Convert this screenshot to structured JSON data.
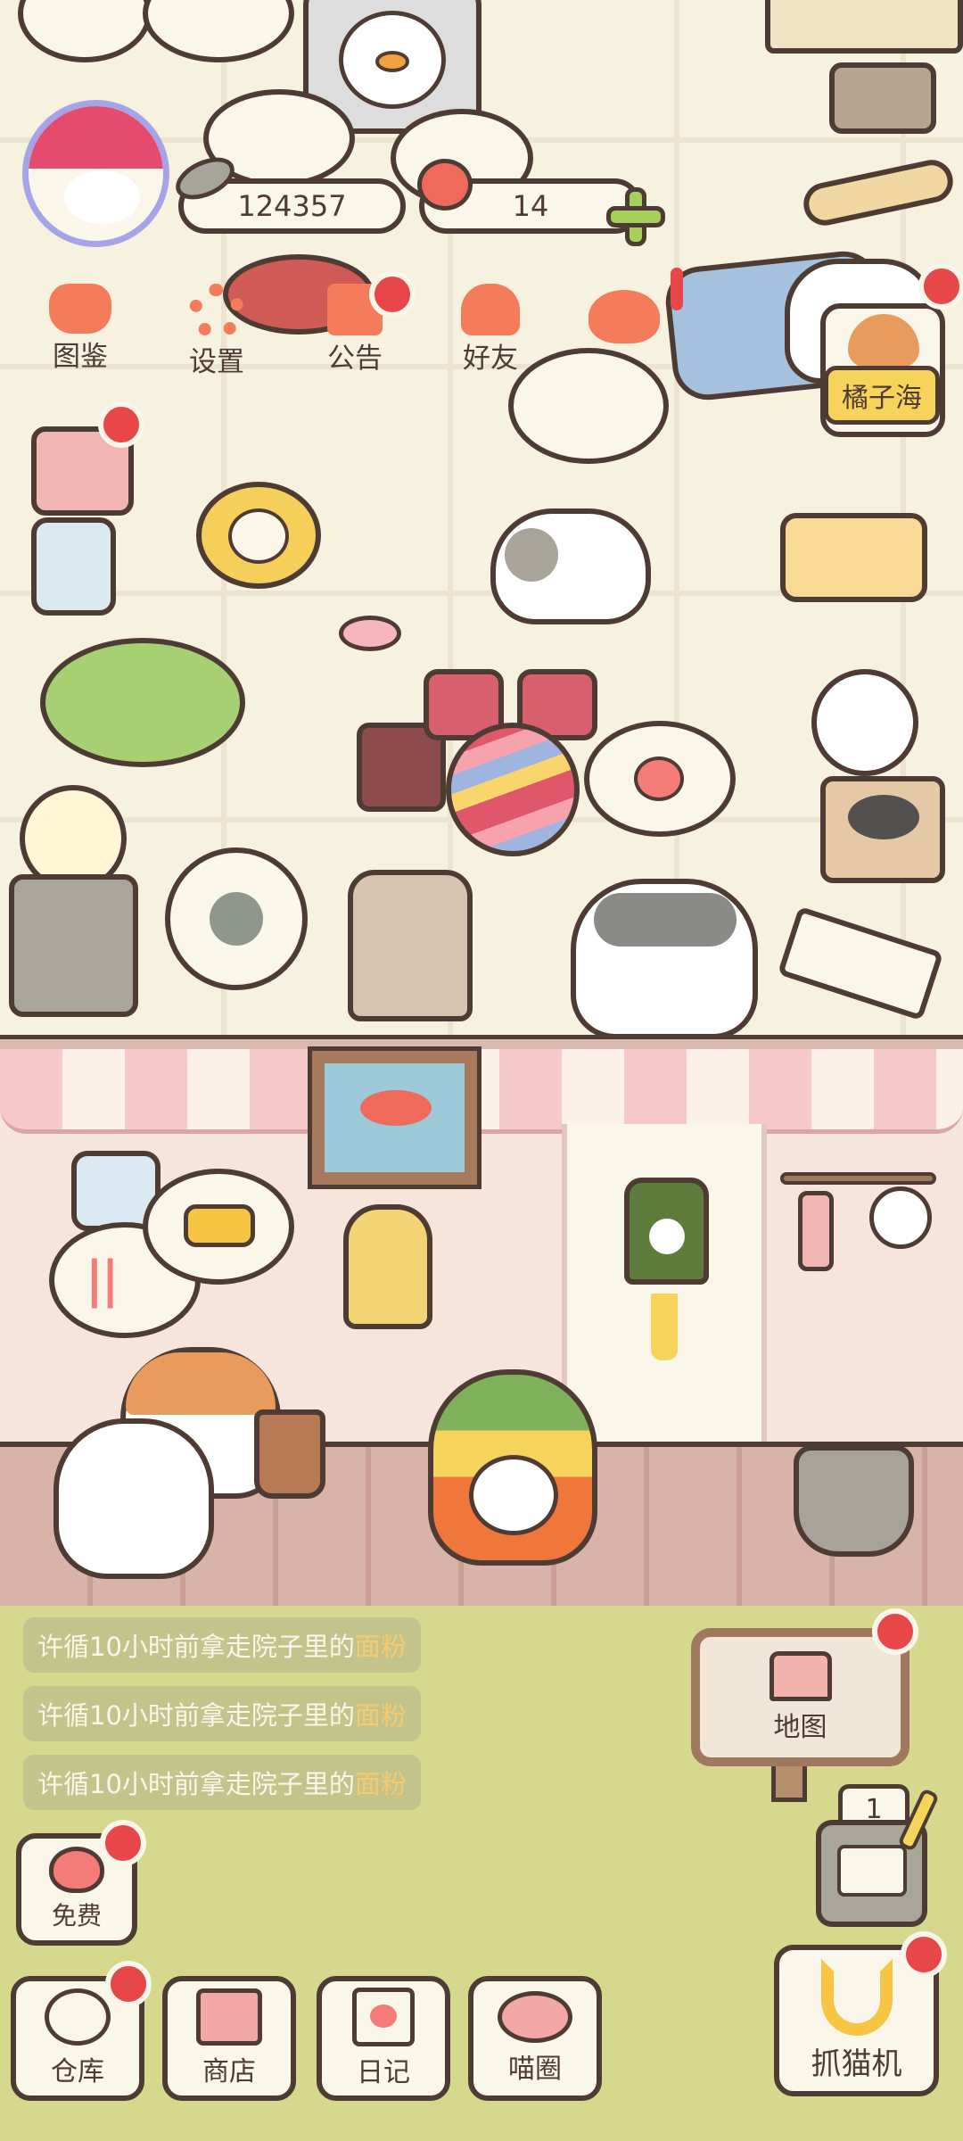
{
  "header": {
    "fish_currency": "124357",
    "apple_currency": "14"
  },
  "menu": [
    {
      "label": "图鉴"
    },
    {
      "label": "设置"
    },
    {
      "label": "公告"
    },
    {
      "label": "好友"
    }
  ],
  "player_tag": "橘子海",
  "messages": [
    {
      "prefix": "许循10小时前拿走院子里的",
      "item": "面粉"
    },
    {
      "prefix": "许循10小时前拿走院子里的",
      "item": "面粉"
    },
    {
      "prefix": "许循10小时前拿走院子里的",
      "item": "面粉"
    }
  ],
  "map_button": "地图",
  "slot_count": "1",
  "free_button": "免费",
  "bottom_nav": [
    {
      "label": "仓库"
    },
    {
      "label": "商店"
    },
    {
      "label": "日记"
    },
    {
      "label": "喵圈"
    }
  ],
  "claw_button": "抓猫机",
  "colors": {
    "outline": "#4e3b33",
    "cream": "#fbf6ea",
    "red_badge": "#e8474a",
    "grass": "#d7d98d",
    "coral": "#f07a5a"
  }
}
